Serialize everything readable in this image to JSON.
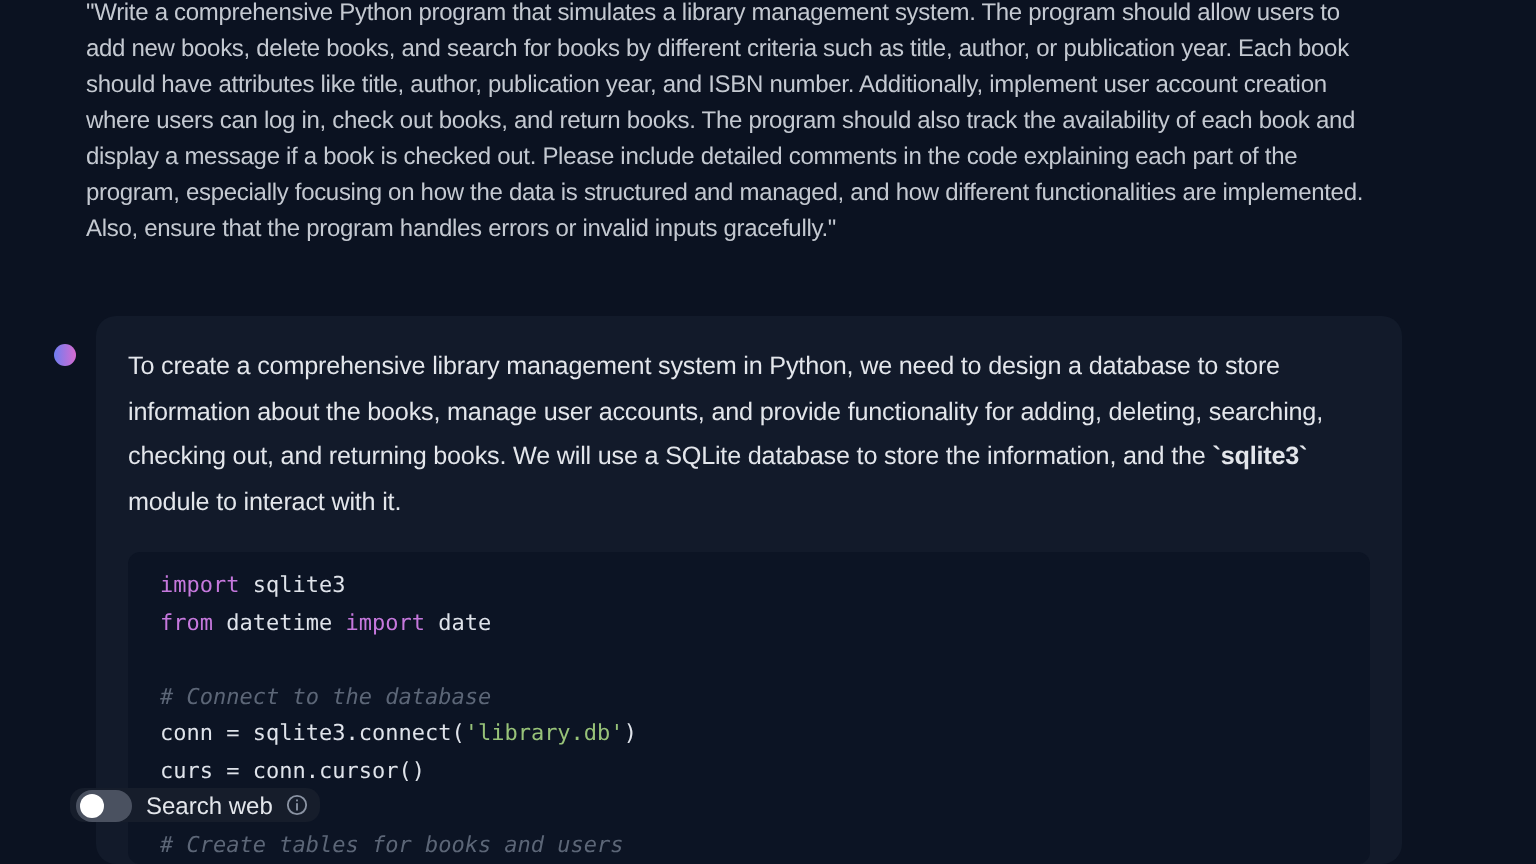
{
  "prompt": "\"Write a comprehensive Python program that simulates a library management system. The program should allow users to add new books, delete books, and search for books by different criteria such as title, author, or publication year. Each book should have attributes like title, author, publication year, and ISBN number. Additionally, implement user account creation where users can log in, check out books, and return books. The program should also track the availability of each book and display a message if a book is checked out. Please include detailed comments in the code explaining each part of the program, especially focusing on how the data is structured and managed, and how different functionalities are implemented. Also, ensure that the program handles errors or invalid inputs gracefully.\"",
  "answer": {
    "paragraph": "To create a comprehensive library management system in Python, we need to design a database to store information about the books, manage user accounts, and provide functionality for adding, deleting, searching, checking out, and returning books. We will use a SQLite database to store the information, and the **`sqlite3`** module to interact with it.",
    "code": [
      [
        {
          "kind": "keyword",
          "text": "import"
        },
        {
          "kind": "plain",
          "text": " sqlite3"
        }
      ],
      [
        {
          "kind": "keyword",
          "text": "from"
        },
        {
          "kind": "plain",
          "text": " datetime "
        },
        {
          "kind": "keyword",
          "text": "import"
        },
        {
          "kind": "plain",
          "text": " date"
        }
      ],
      [
        {
          "kind": "blank"
        }
      ],
      [
        {
          "kind": "comment",
          "text": "# Connect to the database"
        }
      ],
      [
        {
          "kind": "plain",
          "text": "conn = sqlite3.connect("
        },
        {
          "kind": "string",
          "text": "'library.db'"
        },
        {
          "kind": "plain",
          "text": ")"
        }
      ],
      [
        {
          "kind": "plain",
          "text": "curs = conn.cursor()"
        }
      ],
      [
        {
          "kind": "blank"
        }
      ],
      [
        {
          "kind": "comment",
          "text": "# Create tables for books and users"
        }
      ]
    ]
  },
  "search_web": {
    "label": "Search web",
    "on": false
  }
}
